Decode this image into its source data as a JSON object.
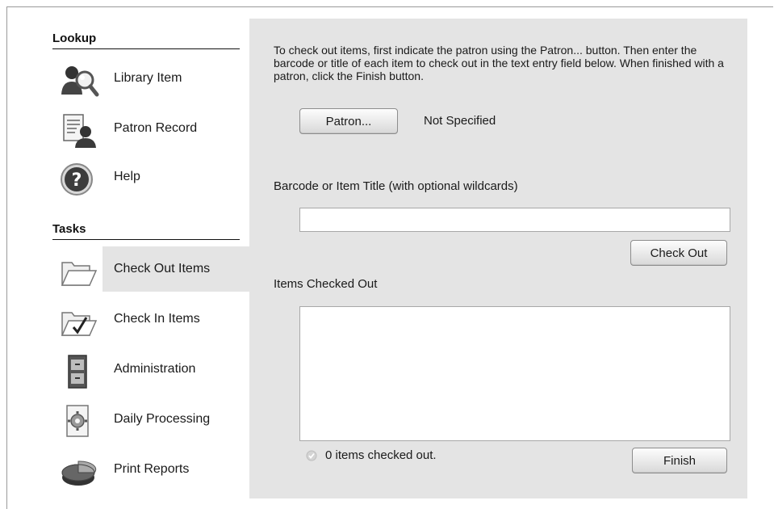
{
  "sidebar": {
    "lookup_title": "Lookup",
    "tasks_title": "Tasks",
    "lookup_items": [
      {
        "label": "Library Item",
        "icon": "library-item-search-icon"
      },
      {
        "label": "Patron Record",
        "icon": "patron-record-icon"
      },
      {
        "label": "Help",
        "icon": "help-icon"
      }
    ],
    "task_items": [
      {
        "label": "Check Out Items",
        "icon": "open-folder-icon",
        "selected": true
      },
      {
        "label": "Check In Items",
        "icon": "folder-check-icon",
        "selected": false
      },
      {
        "label": "Administration",
        "icon": "cabinet-icon",
        "selected": false
      },
      {
        "label": "Daily Processing",
        "icon": "gear-document-icon",
        "selected": false
      },
      {
        "label": "Print Reports",
        "icon": "pie-chart-icon",
        "selected": false
      }
    ]
  },
  "main": {
    "instructions": "To check out items, first indicate the patron using the Patron... button. Then enter the barcode or title of each item to check out in the text entry field below. When finished with a patron, click the Finish button.",
    "patron_button": "Patron...",
    "patron_status": "Not Specified",
    "barcode_label": "Barcode or Item Title (with optional wildcards)",
    "barcode_value": "",
    "check_out_button": "Check Out",
    "items_label": "Items Checked Out",
    "items": [],
    "status_text": "0 items checked out.",
    "finish_button": "Finish"
  }
}
